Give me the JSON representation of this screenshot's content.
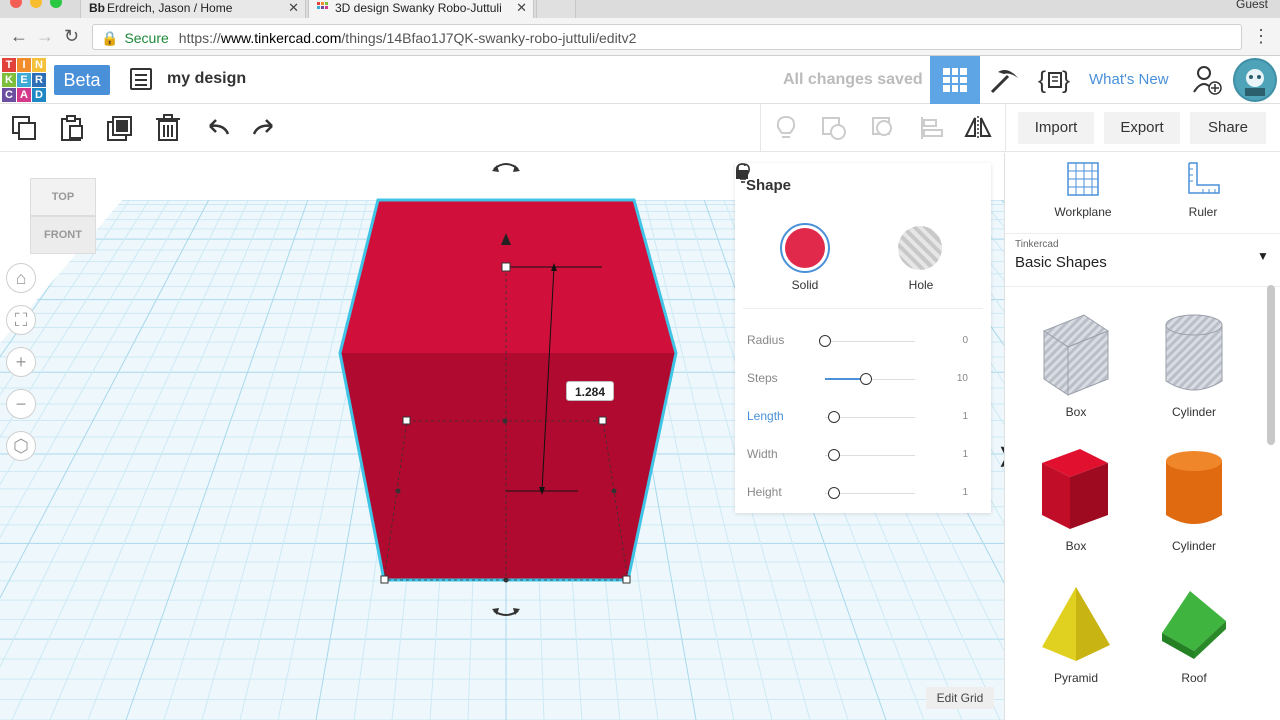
{
  "browser": {
    "tabs": [
      {
        "favicon": "Bb",
        "title": "Erdreich, Jason / Home"
      },
      {
        "favicon": "grid-icon",
        "title": "3D design Swanky Robo-Juttuli"
      }
    ],
    "guest_label": "Guest",
    "address": {
      "secure_label": "Secure",
      "url_scheme": "https://",
      "url_host": "www.tinkercad.com",
      "url_path": "/things/14Bfao1J7QK-swanky-robo-juttuli/editv2"
    }
  },
  "header": {
    "logo_letters": [
      "T",
      "I",
      "N",
      "K",
      "E",
      "R",
      "C",
      "A",
      "D"
    ],
    "logo_colors": [
      "#e2403a",
      "#f08c2c",
      "#f6c13a",
      "#7dbf3b",
      "#3fa9d6",
      "#2c6fb6",
      "#6b4ea0",
      "#d4388a",
      "#1f88c4"
    ],
    "beta_label": "Beta",
    "design_name": "my design",
    "save_status": "All changes saved",
    "whats_new_label": "What's New"
  },
  "toolbar": {
    "import_label": "Import",
    "export_label": "Export",
    "share_label": "Share"
  },
  "viewport": {
    "viewcube": {
      "top_label": "TOP",
      "front_label": "FRONT"
    },
    "measure_value": "1.284",
    "edit_grid_label": "Edit Grid",
    "shape_color": "#d0103a"
  },
  "inspector": {
    "title": "Shape",
    "solid_label": "Solid",
    "hole_label": "Hole",
    "params": [
      {
        "name": "Radius",
        "value": "0",
        "fraction": 0.0
      },
      {
        "name": "Steps",
        "value": "10",
        "fraction": 0.45
      },
      {
        "name": "Length",
        "value": "1",
        "fraction": 0.1
      },
      {
        "name": "Width",
        "value": "1",
        "fraction": 0.1
      },
      {
        "name": "Height",
        "value": "1",
        "fraction": 0.1
      }
    ]
  },
  "right_panel": {
    "workplane_label": "Workplane",
    "ruler_label": "Ruler",
    "library_caption": "Tinkercad",
    "library_name": "Basic Shapes",
    "shapes": [
      {
        "label": "Box",
        "kind": "box-hole"
      },
      {
        "label": "Cylinder",
        "kind": "cylinder-hole"
      },
      {
        "label": "Box",
        "kind": "box-solid"
      },
      {
        "label": "Cylinder",
        "kind": "cylinder-solid"
      },
      {
        "label": "Pyramid",
        "kind": "pyramid"
      },
      {
        "label": "Roof",
        "kind": "roof"
      }
    ]
  }
}
